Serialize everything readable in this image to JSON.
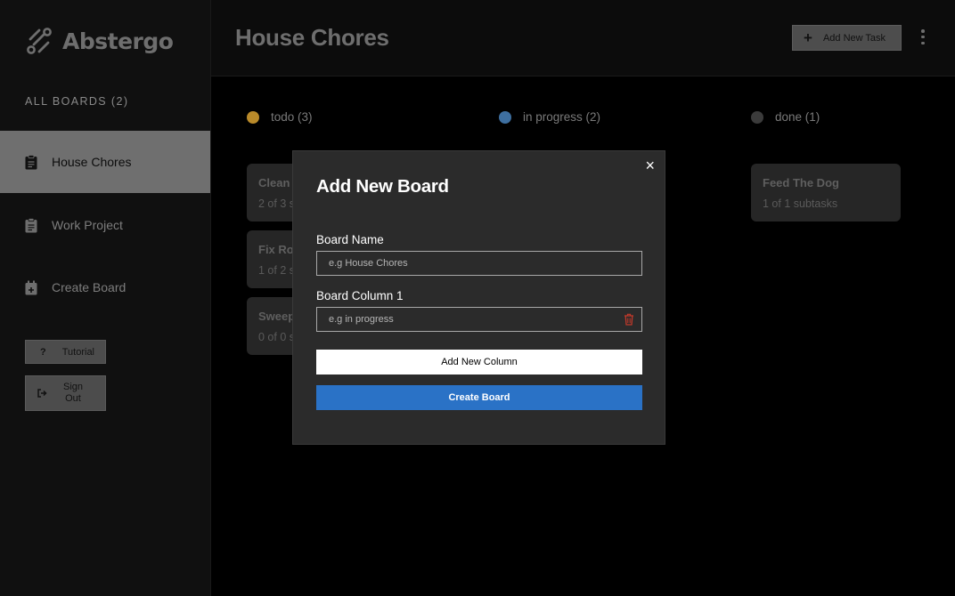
{
  "app": {
    "name": "Abstergo"
  },
  "sidebar": {
    "all_boards_label": "ALL BOARDS (2)",
    "boards": [
      {
        "label": "House Chores",
        "active": true
      },
      {
        "label": "Work Project",
        "active": false
      }
    ],
    "create_board_label": "Create Board",
    "tutorial_label": "Tutorial",
    "tutorial_icon": "?",
    "sign_out_label": "Sign Out"
  },
  "header": {
    "title": "House Chores",
    "add_task_label": "Add New Task"
  },
  "columns": [
    {
      "label": "todo (3)",
      "color": "#b98a2a"
    },
    {
      "label": "in progress (2)",
      "color": "#3e6fa0"
    },
    {
      "label": "done (1)",
      "color": "#3b3b3b"
    }
  ],
  "todo_cards": [
    {
      "title": "Clean",
      "subtasks": "2 of 3 s"
    },
    {
      "title": "Fix Ro",
      "subtasks": "1 of 2 s"
    },
    {
      "title": "Sweep",
      "subtasks": "0 of 0 s"
    }
  ],
  "done_cards": [
    {
      "title": "Feed The Dog",
      "subtasks": "1 of 1 subtasks"
    }
  ],
  "modal": {
    "title": "Add New Board",
    "close_icon": "×",
    "board_name_label": "Board Name",
    "board_name_placeholder": "e.g House Chores",
    "column_label": "Board Column 1",
    "column_placeholder": "e.g in progress",
    "add_column_label": "Add New Column",
    "create_label": "Create Board"
  },
  "colors": {
    "accent_blue": "#2a72c6",
    "delete_red": "#c0392b"
  }
}
